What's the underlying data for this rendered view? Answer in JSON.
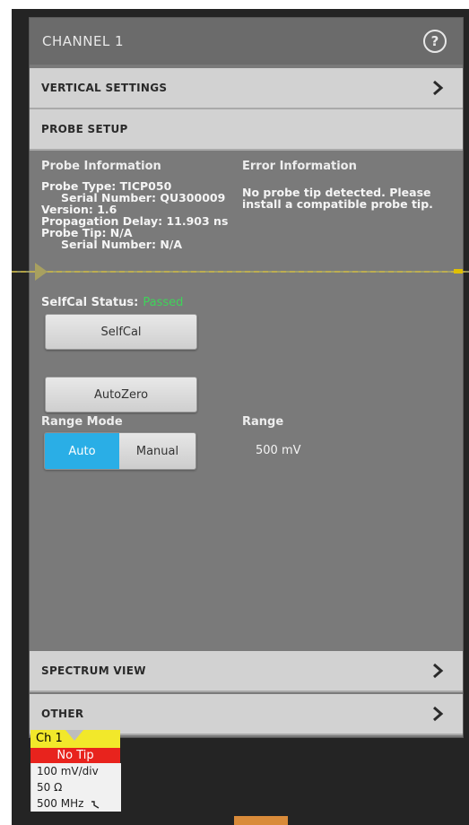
{
  "panel": {
    "title": "CHANNEL 1",
    "help_icon": "help-circle-icon"
  },
  "sections": {
    "vertical_settings": "VERTICAL SETTINGS",
    "probe_setup": "PROBE SETUP",
    "spectrum_view": "SPECTRUM VIEW",
    "other": "OTHER"
  },
  "probe": {
    "info_heading": "Probe Information",
    "probe_type": "Probe Type: TICP050",
    "serial_number": "Serial Number: QU300009",
    "version": "Version: 1.6",
    "propagation_delay": "Propagation Delay: 11.903 ns",
    "probe_tip": "Probe Tip: N/A",
    "tip_serial_number": "Serial Number: N/A"
  },
  "error": {
    "heading": "Error Information",
    "message": "No probe tip detected. Please install a compatible probe tip."
  },
  "selfcal": {
    "status_label": "SelfCal Status:",
    "status_value": "Passed",
    "status_color": "#3fd35a",
    "button_label": "SelfCal"
  },
  "autozero": {
    "button_label": "AutoZero"
  },
  "range_mode": {
    "label": "Range Mode",
    "options": [
      "Auto",
      "Manual"
    ],
    "selected": "Auto",
    "accent_color": "#2aaee6"
  },
  "range": {
    "label": "Range",
    "value": "500 mV"
  },
  "channel_badge": {
    "title": "Ch 1",
    "status": "No Tip",
    "scale": "100 mV/div",
    "impedance": "50 Ω",
    "bandwidth": "500 MHz",
    "bandwidth_icon": "bandwidth-limit-icon",
    "title_color": "#f2e82a",
    "status_color": "#e8231d"
  }
}
